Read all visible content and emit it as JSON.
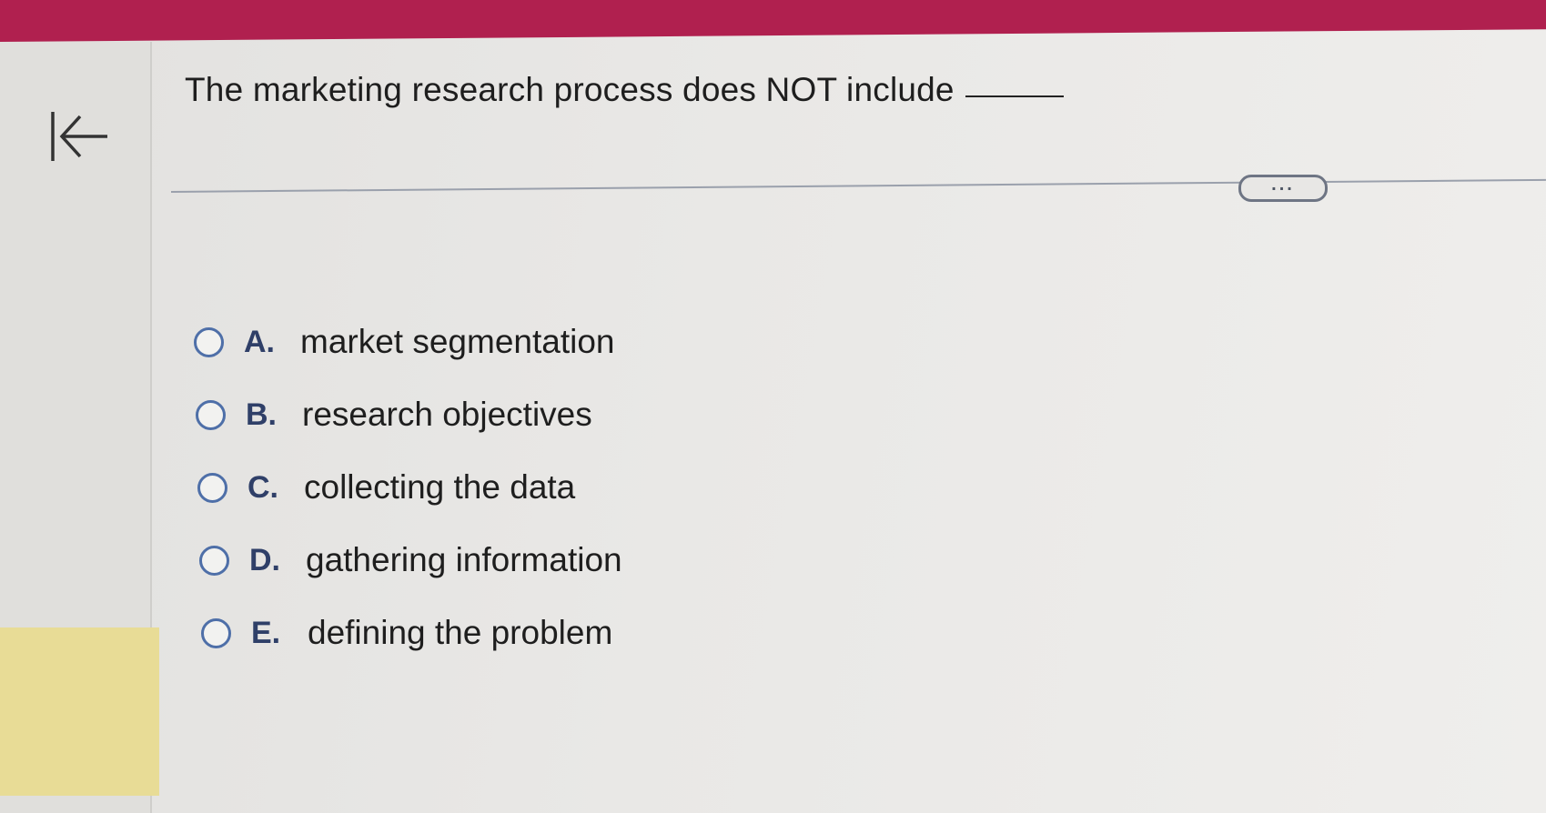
{
  "question": {
    "text": "The marketing research process does NOT include"
  },
  "toolbar": {
    "more_label": "..."
  },
  "options": [
    {
      "letter": "A.",
      "text": "market segmentation"
    },
    {
      "letter": "B.",
      "text": "research objectives"
    },
    {
      "letter": "C.",
      "text": "collecting the data"
    },
    {
      "letter": "D.",
      "text": "gathering information"
    },
    {
      "letter": "E.",
      "text": "defining the problem"
    }
  ],
  "colors": {
    "header": "#b0204f",
    "radio": "#4e6fa8",
    "highlight": "#e8dc96"
  },
  "icons": {
    "collapse": "arrow-left-to-bar-icon",
    "radio": "radio-empty-icon"
  }
}
